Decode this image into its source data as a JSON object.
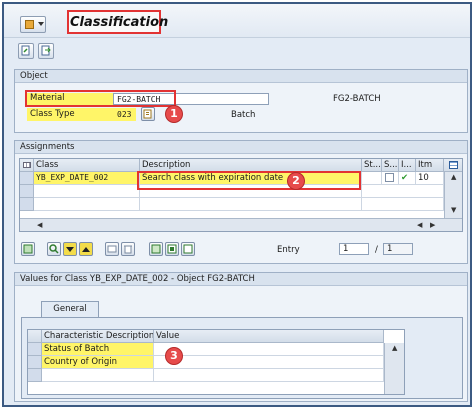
{
  "header": {
    "title": "Classification"
  },
  "object_group": {
    "title": "Object",
    "material_label": "Material",
    "material_value": "FG2-BATCH",
    "material_desc": "FG2-BATCH",
    "class_type_label": "Class Type",
    "class_type_value": "023",
    "class_type_desc": "Batch"
  },
  "assignments_group": {
    "title": "Assignments",
    "columns": [
      "Class",
      "Description",
      "St...",
      "S...",
      "I...",
      "Itm"
    ],
    "rows": [
      {
        "class": "YB_EXP_DATE_002",
        "description": "Search class with expiration date",
        "status": "",
        "standard": "",
        "indicator": "✔",
        "item": "10"
      }
    ],
    "entry_label": "Entry",
    "entry_value": "1",
    "entry_separator": "/",
    "entry_total": "1"
  },
  "values_group": {
    "title": "Values for Class YB_EXP_DATE_002 - Object FG2-BATCH",
    "tab_label": "General",
    "columns": [
      "Characteristic Description",
      "Value"
    ],
    "rows": [
      {
        "characteristic": "Status of Batch",
        "value": ""
      },
      {
        "characteristic": "Country of Origin",
        "value": ""
      }
    ]
  },
  "callouts": [
    "1",
    "2",
    "3"
  ],
  "colors": {
    "highlight": "#fff568",
    "callout_red": "#e64b4b",
    "check_green": "#2e9a2e",
    "frame_blue": "#3c5a82"
  }
}
